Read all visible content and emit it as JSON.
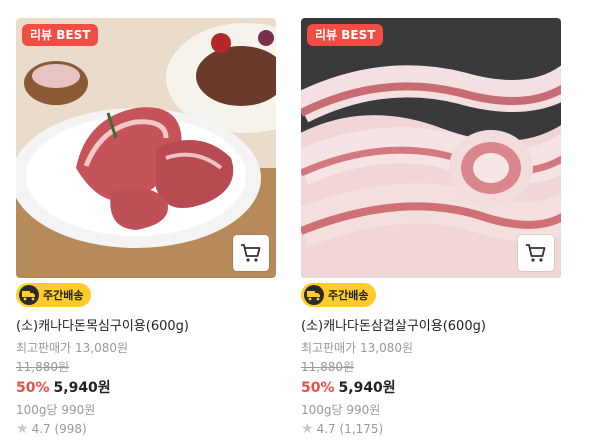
{
  "products": [
    {
      "badge": "리뷰 BEST",
      "delivery": "주간배송",
      "name": "(소)캐나다돈목심구이용(600g)",
      "lowest_price": "최고판매가 13,080원",
      "original_price": "11,880원",
      "discount": "50%",
      "price": "5,940원",
      "unit_price": "100g당 990원",
      "rating": "4.7 (998)",
      "icons": [
        "cart-icon",
        "truck-icon",
        "star-icon"
      ]
    },
    {
      "badge": "리뷰 BEST",
      "delivery": "주간배송",
      "name": "(소)캐나다돈삼겹살구이용(600g)",
      "lowest_price": "최고판매가 13,080원",
      "original_price": "11,880원",
      "discount": "50%",
      "price": "5,940원",
      "unit_price": "100g당 990원",
      "rating": "4.7 (1,175)",
      "icons": [
        "cart-icon",
        "truck-icon",
        "star-icon"
      ]
    }
  ],
  "colors": {
    "badge": "#f04e45",
    "discount": "#f04e45",
    "delivery": "#ffcc29",
    "muted": "#999999"
  }
}
